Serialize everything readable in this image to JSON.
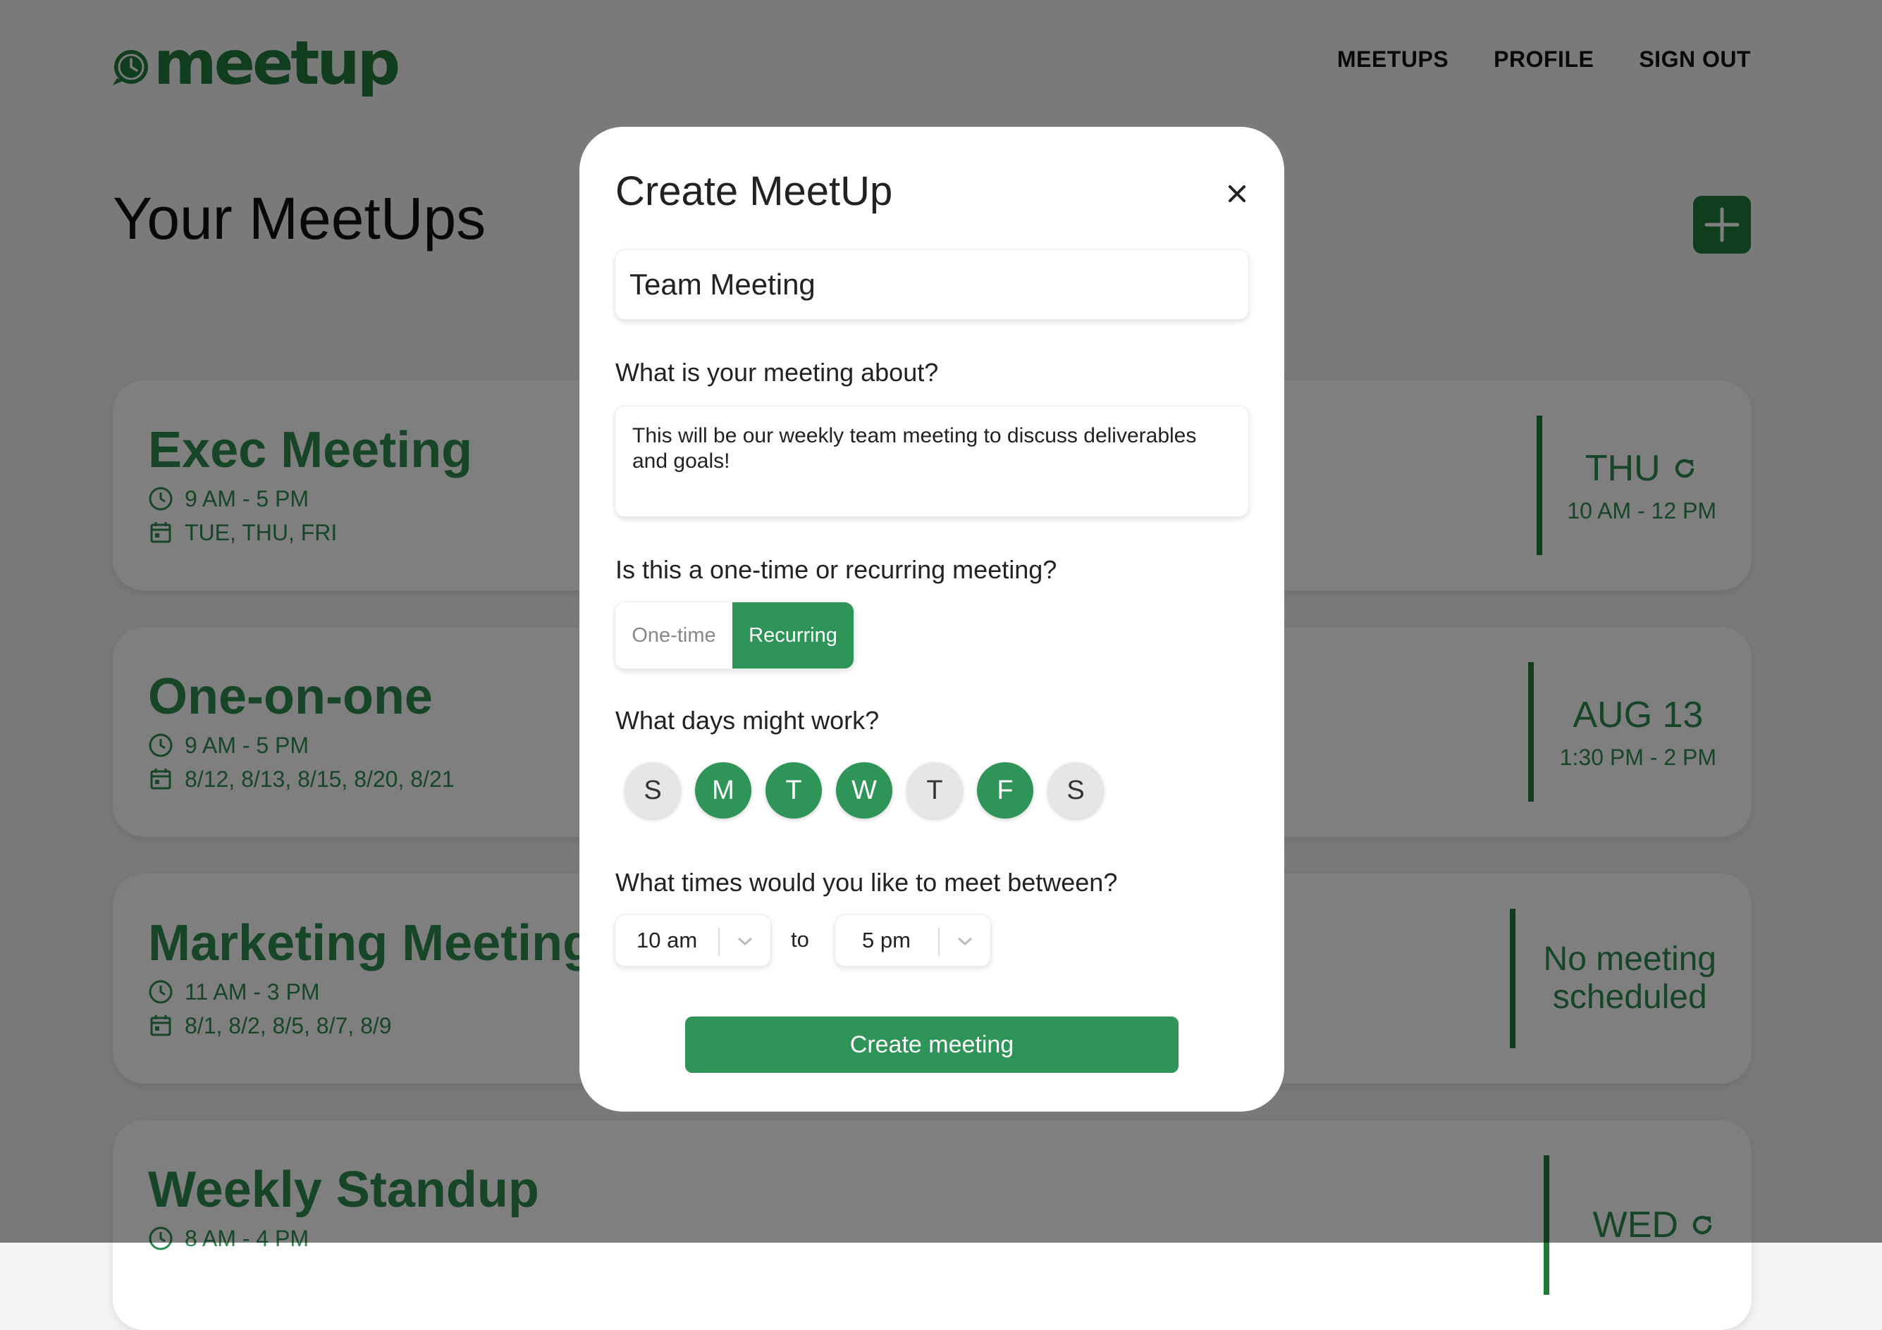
{
  "brand": {
    "name": "meetup",
    "color": "#1f7a3a"
  },
  "nav": {
    "meetups": "MEETUPS",
    "profile": "PROFILE",
    "sign_out": "SIGN OUT"
  },
  "page": {
    "title": "Your MeetUps",
    "add_icon": "plus-icon"
  },
  "cards": [
    {
      "title": "Exec Meeting",
      "time": "9 AM - 5 PM",
      "days": "TUE, THU, FRI",
      "right_day": "THU",
      "right_recurring": true,
      "right_time": "10 AM - 12 PM"
    },
    {
      "title": "One-on-one",
      "time": "9 AM - 5 PM",
      "days": "8/12, 8/13, 8/15, 8/20, 8/21",
      "right_day": "AUG 13",
      "right_recurring": false,
      "right_time": "1:30 PM - 2 PM"
    },
    {
      "title": "Marketing Meeting",
      "time": "11 AM - 3 PM",
      "days": "8/1, 8/2, 8/5, 8/7, 8/9",
      "right_line1": "No meeting",
      "right_line2": "scheduled"
    },
    {
      "title": "Weekly Standup",
      "time": "8 AM - 4 PM",
      "right_day": "WED",
      "right_recurring": true
    }
  ],
  "modal": {
    "title": "Create MeetUp",
    "close_icon": "close-icon",
    "name_value": "Team Meeting",
    "about_label": "What is your meeting about?",
    "about_value": "This will be our weekly team meeting to discuss deliverables and goals!",
    "type_label": "Is this a one-time or recurring meeting?",
    "type_options": [
      "One-time",
      "Recurring"
    ],
    "type_selected": "Recurring",
    "days_label": "What days might work?",
    "days": [
      {
        "letter": "S",
        "selected": false
      },
      {
        "letter": "M",
        "selected": true
      },
      {
        "letter": "T",
        "selected": true
      },
      {
        "letter": "W",
        "selected": true
      },
      {
        "letter": "T",
        "selected": false
      },
      {
        "letter": "F",
        "selected": true
      },
      {
        "letter": "S",
        "selected": false
      }
    ],
    "times_label": "What times would you like to meet between?",
    "time_from": "10 am",
    "time_to_label": "to",
    "time_to": "5 pm",
    "submit_label": "Create meeting"
  },
  "colors": {
    "accent": "#2e9457",
    "accent_dark": "#1f7a3a",
    "overlay": "rgba(0,0,0,0.5)"
  }
}
